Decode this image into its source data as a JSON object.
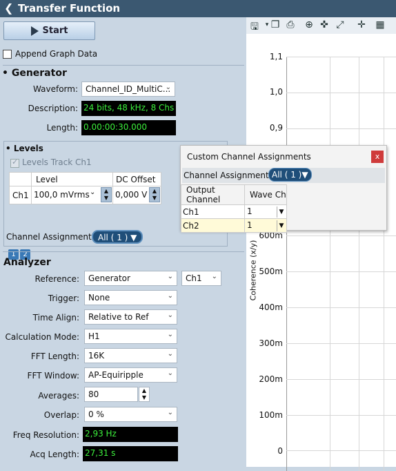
{
  "title": "Transfer Function",
  "start_label": "Start",
  "append_label": "Append Graph Data",
  "generator": {
    "heading": "Generator",
    "waveform_label": "Waveform:",
    "waveform_value": "Channel_ID_MultiC...",
    "description_label": "Description:",
    "description_value": "24 bits, 48 kHz, 8 Chs",
    "length_label": "Length:",
    "length_value": "0.00:00:30.000"
  },
  "levels": {
    "heading": "• Levels",
    "track_label": "Levels Track Ch1",
    "col_level": "Level",
    "col_dc": "DC Offset",
    "row_ch": "Ch1",
    "row_level": "100,0 mVrms",
    "row_dc": "0,000 V",
    "assign_label": "Channel Assignments:",
    "assign_value": "All ( 1 )",
    "page1": "1",
    "page2": "2"
  },
  "analyzer": {
    "heading": "Analyzer",
    "reference_label": "Reference:",
    "reference_value": "Generator",
    "reference_ch": "Ch1",
    "trigger_label": "Trigger:",
    "trigger_value": "None",
    "timealign_label": "Time Align:",
    "timealign_value": "Relative to Ref",
    "calc_label": "Calculation Mode:",
    "calc_value": "H1",
    "fftlen_label": "FFT Length:",
    "fftlen_value": "16K",
    "fftwin_label": "FFT Window:",
    "fftwin_value": "AP-Equiripple",
    "avg_label": "Averages:",
    "avg_value": "80",
    "overlap_label": "Overlap:",
    "overlap_value": "0 %",
    "freqres_label": "Freq Resolution:",
    "freqres_value": "2,93 Hz",
    "acq_label": "Acq Length:",
    "acq_value": "27,31 s"
  },
  "graph": {
    "ylabel": "Coherence (x/y)",
    "ticks": [
      "1,1",
      "1,0",
      "0,9",
      "600m",
      "500m",
      "400m",
      "300m",
      "200m",
      "100m",
      "0"
    ]
  },
  "popup": {
    "title": "Custom Channel Assignments",
    "close": "x",
    "assign_label": "Channel Assignments:",
    "assign_value": "All ( 1 )",
    "col_output": "Output Channel",
    "col_wave": "Wave Ch",
    "rows": [
      {
        "out": "Ch1",
        "wave": "1"
      },
      {
        "out": "Ch2",
        "wave": "1"
      }
    ]
  }
}
